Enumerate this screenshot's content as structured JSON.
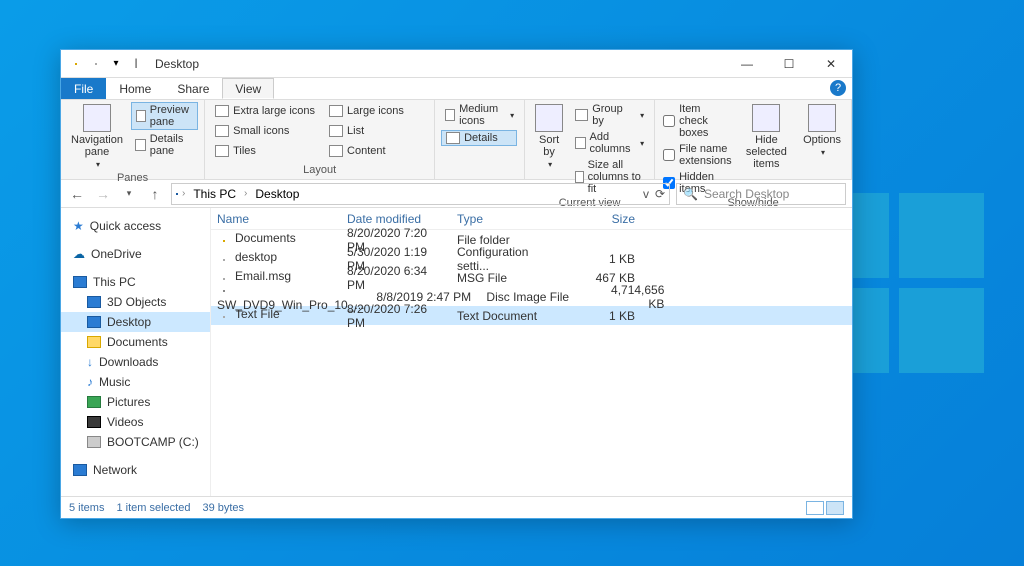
{
  "window": {
    "title": "Desktop",
    "minimize": "—",
    "maximize": "☐",
    "close": "✕"
  },
  "menutabs": {
    "file": "File",
    "home": "Home",
    "share": "Share",
    "view": "View",
    "help": "?"
  },
  "ribbon": {
    "panes": {
      "label": "Panes",
      "nav": "Navigation pane",
      "preview": "Preview pane",
      "details": "Details pane"
    },
    "layout": {
      "label": "Layout",
      "xl": "Extra large icons",
      "lg": "Large icons",
      "md": "Medium icons",
      "sm": "Small icons",
      "list": "List",
      "content": "Content",
      "details": "Details"
    },
    "current": {
      "label": "Current view",
      "sort": "Sort by",
      "group": "Group by",
      "addcols": "Add columns",
      "sizecols": "Size all columns to fit"
    },
    "showhide": {
      "label": "Show/hide",
      "checkboxes": "Item check boxes",
      "ext": "File name extensions",
      "hidden": "Hidden items",
      "hidesel": "Hide selected items",
      "options": "Options"
    }
  },
  "addr": {
    "thispc": "This PC",
    "desktop": "Desktop",
    "refresh": "⟳",
    "drop": "v"
  },
  "search": {
    "placeholder": "Search Desktop",
    "icon": "🔍"
  },
  "nav": {
    "quick": "Quick access",
    "onedrive": "OneDrive",
    "thispc": "This PC",
    "obj3d": "3D Objects",
    "desktop": "Desktop",
    "documents": "Documents",
    "downloads": "Downloads",
    "music": "Music",
    "pictures": "Pictures",
    "videos": "Videos",
    "bootcamp": "BOOTCAMP (C:)",
    "network": "Network"
  },
  "cols": {
    "name": "Name",
    "date": "Date modified",
    "type": "Type",
    "size": "Size"
  },
  "files": [
    {
      "icon": "folder",
      "name": "Documents",
      "date": "8/20/2020 7:20 PM",
      "type": "File folder",
      "size": ""
    },
    {
      "icon": "file",
      "name": "desktop",
      "date": "5/30/2020 1:19 PM",
      "type": "Configuration setti...",
      "size": "1 KB"
    },
    {
      "icon": "file",
      "name": "Email.msg",
      "date": "8/20/2020 6:34 PM",
      "type": "MSG File",
      "size": "467 KB"
    },
    {
      "icon": "disk",
      "name": "SW_DVD9_Win_Pro_10_...",
      "date": "8/8/2019 2:47 PM",
      "type": "Disc Image File",
      "size": "4,714,656 KB"
    },
    {
      "icon": "file",
      "name": "Text File",
      "date": "8/20/2020 7:26 PM",
      "type": "Text Document",
      "size": "1 KB",
      "selected": true
    }
  ],
  "status": {
    "count": "5 items",
    "sel": "1 item selected",
    "bytes": "39 bytes"
  }
}
